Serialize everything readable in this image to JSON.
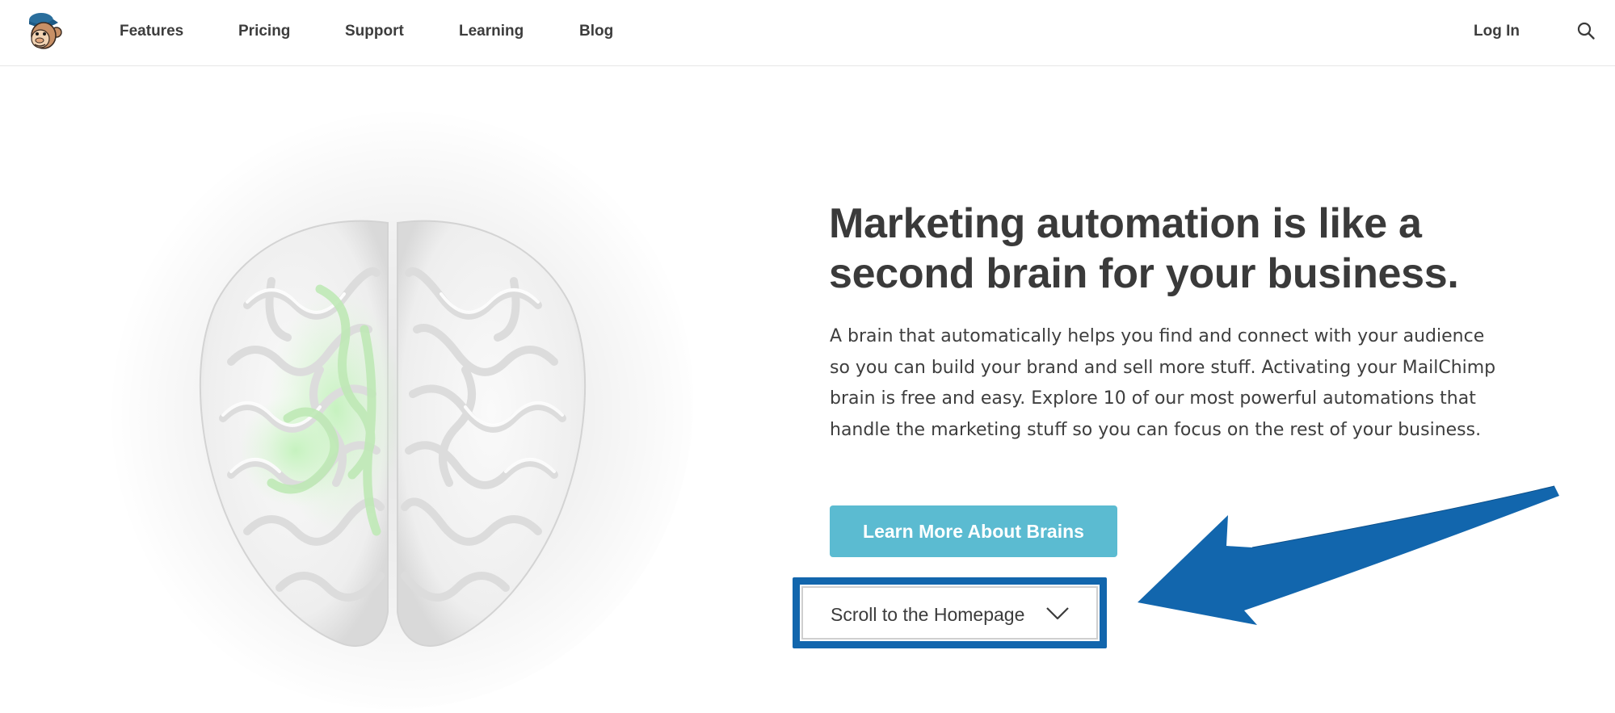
{
  "header": {
    "logo_icon": "mailchimp-monkey-icon",
    "nav": [
      {
        "label": "Features"
      },
      {
        "label": "Pricing"
      },
      {
        "label": "Support"
      },
      {
        "label": "Learning"
      },
      {
        "label": "Blog"
      }
    ],
    "login_label": "Log In",
    "search_icon": "search-icon"
  },
  "hero": {
    "image_icon": "brain-illustration",
    "headline": "Marketing automation is like a second brain for your business.",
    "description": "A brain that automatically helps you find and connect with your audience so you can build your brand and sell more stuff. Activating your MailChimp brain is free and easy. Explore 10 of our most powerful automations that handle the marketing stuff so you can focus on the rest of your business.",
    "cta_label": "Learn More About Brains",
    "scroll_label": "Scroll to the Homepage",
    "scroll_icon": "chevron-down-icon"
  },
  "annotation": {
    "arrow_icon": "pointer-arrow-icon",
    "color": "#1266ad"
  },
  "colors": {
    "cta": "#5bbbd1",
    "text": "#3c3c3c",
    "highlight": "#1266ad"
  }
}
